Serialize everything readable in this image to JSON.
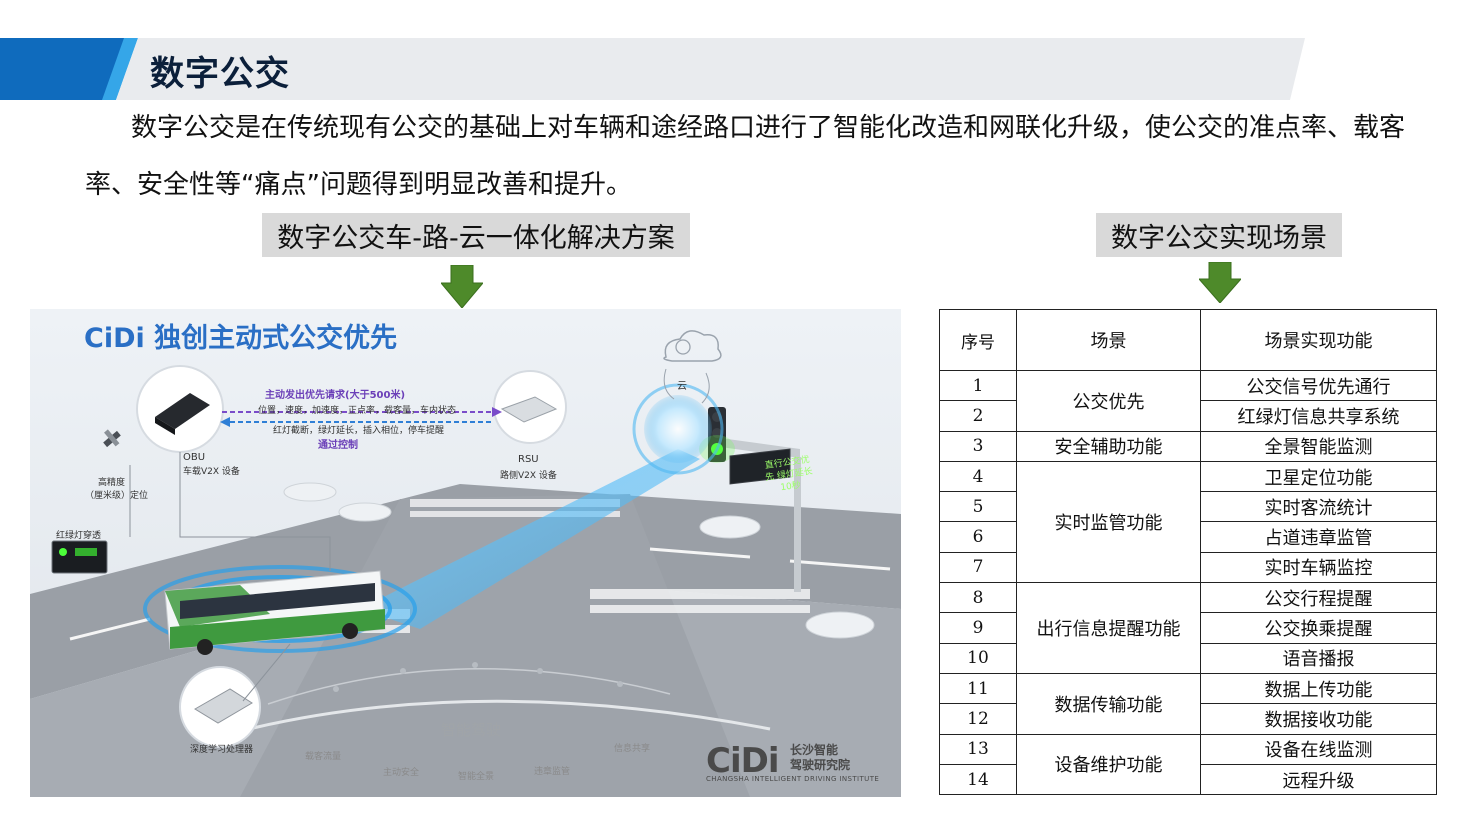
{
  "page": {
    "title": "数字公交",
    "intro": "数字公交是在传统现有公交的基础上对车辆和途经路口进行了智能化改造和网联化升级，使公交的准点率、载客率、安全性等“痛点”问题得到明显改善和提升。",
    "left_heading": "数字公交车-路-云一体化解决方案",
    "right_heading": "数字公交实现场景"
  },
  "colors": {
    "title_blue": "#0f6bbd",
    "heading_bg": "#d9d9d9",
    "arrow_green": "#4e8a2a",
    "fig_title": "#2a6fc5"
  },
  "figure": {
    "title": "CiDi 独创主动式公交优先",
    "request_label": "主动发出优先请求(大于500米)",
    "info_line1": "位置，速度，加速度，正点率，载客量，车内状态",
    "info_line2": "红灯截断，绿灯延长，插入相位，停车提醒",
    "control_label": "通过控制",
    "obu_name": "OBU",
    "obu_desc": "车载V2X 设备",
    "rsu_name": "RSU",
    "rsu_desc": "路侧V2X 设备",
    "cloud_label": "云",
    "gps_label1": "高精度",
    "gps_label2": "（厘米级）定位",
    "signal_label": "红绿灯穿透",
    "sign_text": "直行公交优先 绿灯延长10秒",
    "processor_label": "深度学习处理器",
    "smart_drive": "智能驾驶",
    "features": [
      "载客流量",
      "主动安全",
      "智能全景",
      "违章监管",
      "信息共享"
    ],
    "logo_main": "CiDi",
    "logo_cn_line1": "长沙智能",
    "logo_cn_line2": "驾驶研究院",
    "logo_en": "CHANGSHA INTELLIGENT DRIVING INSTITUTE"
  },
  "table": {
    "headers": [
      "序号",
      "场景",
      "场景实现功能"
    ],
    "numbers": [
      "1",
      "2",
      "3",
      "4",
      "5",
      "6",
      "7",
      "8",
      "9",
      "10",
      "11",
      "12",
      "13",
      "14"
    ],
    "scenes": [
      "公交优先",
      "安全辅助功能",
      "实时监管功能",
      "出行信息提醒功能",
      "数据传输功能",
      "设备维护功能"
    ],
    "functions": [
      "公交信号优先通行",
      "红绿灯信息共享系统",
      "全景智能监测",
      "卫星定位功能",
      "实时客流统计",
      "占道违章监管",
      "实时车辆监控",
      "公交行程提醒",
      "公交换乘提醒",
      "语音播报",
      "数据上传功能",
      "数据接收功能",
      "设备在线监测",
      "远程升级"
    ]
  }
}
